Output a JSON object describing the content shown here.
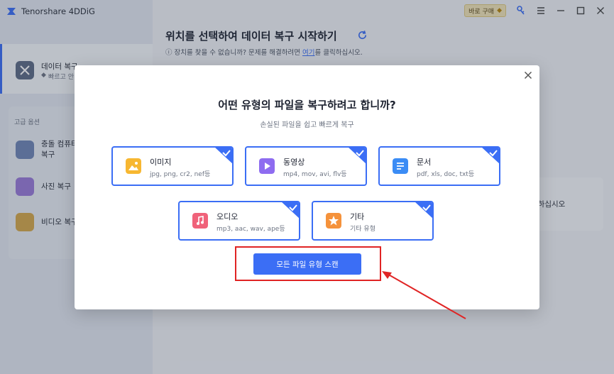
{
  "app": {
    "title": "Tenorshare 4DDiG",
    "buy_badge": "바로 구매"
  },
  "sidebar": {
    "active_item": {
      "label": "데이터 복구",
      "sub": "빠르고 안"
    },
    "section_label": "고급 옵션",
    "items": [
      {
        "line1": "충돌 컴퓨터",
        "line2": "복구"
      },
      {
        "line1": "사진 복구"
      },
      {
        "line1": "비디오 복구"
      }
    ]
  },
  "main": {
    "title": "위치를 선택하여 데이터 복구 시작하기",
    "hint_prefix": "장치를 찾을 수 없습니까? 문제를 해결하려면 ",
    "hint_link": "여기",
    "hint_suffix": "를 클릭하십시오.",
    "right_card_text": "택하십시오"
  },
  "modal": {
    "title": "어떤 유형의 파일을 복구하려고 합니까?",
    "subtitle": "손실된 파일을 쉽고 빠르게 복구",
    "file_types": [
      {
        "name": "이미지",
        "ext": "jpg, png, cr2, nef등",
        "icon": "image-icon",
        "color": "#f7b731"
      },
      {
        "name": "동영상",
        "ext": "mp4, mov, avi, flv등",
        "icon": "video-icon",
        "color": "#8e6cf0"
      },
      {
        "name": "문서",
        "ext": "pdf, xls, doc, txt등",
        "icon": "document-icon",
        "color": "#3b8cf5"
      },
      {
        "name": "오디오",
        "ext": "mp3, aac, wav, ape등",
        "icon": "audio-icon",
        "color": "#f0627a"
      },
      {
        "name": "기타",
        "ext": "기타 유형",
        "icon": "star-icon",
        "color": "#f5923b"
      }
    ],
    "scan_button": "모든 파일 유형 스캔"
  },
  "colors": {
    "accent": "#3b6ef5",
    "annotation": "#e02424"
  }
}
